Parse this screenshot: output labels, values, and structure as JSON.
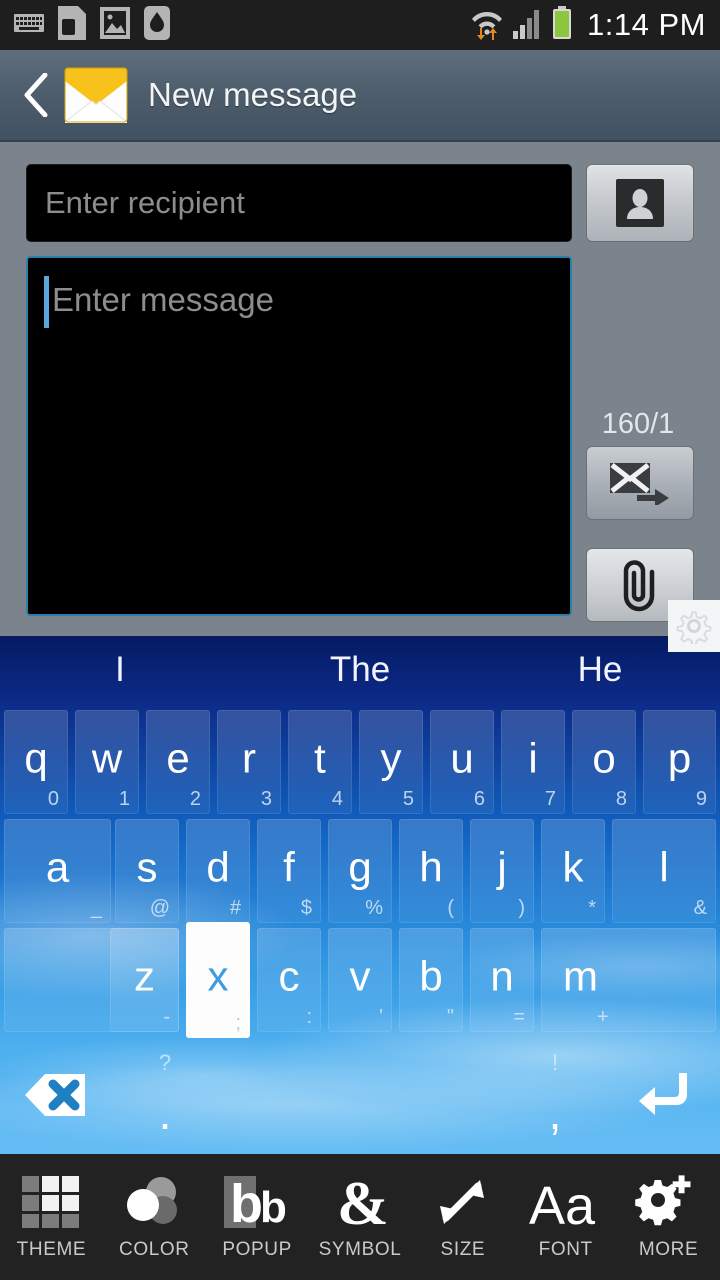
{
  "statusbar": {
    "time": "1:14 PM",
    "left_icons": [
      "keyboard-icon",
      "sim-card-icon",
      "image-icon",
      "droplet-icon"
    ],
    "right_icons": [
      "wifi-icon",
      "signal-icon",
      "battery-icon"
    ]
  },
  "titlebar": {
    "back_label": "‹",
    "icon": "envelope-icon",
    "title": "New message"
  },
  "compose": {
    "recipient_placeholder": "Enter recipient",
    "recipient_value": "",
    "contacts_button": "contacts-icon",
    "message_placeholder": "Enter message",
    "message_value": "",
    "counter": "160/1",
    "send_button": "send-message-icon",
    "attach_button": "paperclip-icon",
    "settings_button": "gear-icon"
  },
  "keyboard": {
    "suggestions": [
      "I",
      "The",
      "He"
    ],
    "rows": [
      [
        {
          "label": "q",
          "hint": "0"
        },
        {
          "label": "w",
          "hint": "1"
        },
        {
          "label": "e",
          "hint": "2"
        },
        {
          "label": "r",
          "hint": "3"
        },
        {
          "label": "t",
          "hint": "4"
        },
        {
          "label": "y",
          "hint": "5"
        },
        {
          "label": "u",
          "hint": "6"
        },
        {
          "label": "i",
          "hint": "7"
        },
        {
          "label": "o",
          "hint": "8"
        },
        {
          "label": "p",
          "hint": "9"
        }
      ],
      [
        {
          "label": "a",
          "hint": "_"
        },
        {
          "label": "s",
          "hint": "@"
        },
        {
          "label": "d",
          "hint": "#"
        },
        {
          "label": "f",
          "hint": "$"
        },
        {
          "label": "g",
          "hint": "%"
        },
        {
          "label": "h",
          "hint": "("
        },
        {
          "label": "j",
          "hint": ")"
        },
        {
          "label": "k",
          "hint": "*"
        },
        {
          "label": "l",
          "hint": "&"
        }
      ],
      [
        {
          "label": "",
          "hint": "",
          "name": "shift-key"
        },
        {
          "label": "z",
          "hint": "-"
        },
        {
          "label": "x",
          "hint": ";",
          "pressed": true
        },
        {
          "label": "c",
          "hint": ":"
        },
        {
          "label": "v",
          "hint": "'"
        },
        {
          "label": "b",
          "hint": "\""
        },
        {
          "label": "n",
          "hint": "="
        },
        {
          "label": "m",
          "hint": "+"
        }
      ]
    ],
    "bottom_row": [
      {
        "name": "backspace-key",
        "main": "",
        "hint": ""
      },
      {
        "name": "period-key",
        "main": ".",
        "hint": "?"
      },
      {
        "name": "space-key",
        "main": "",
        "hint": ""
      },
      {
        "name": "comma-key",
        "main": ",",
        "hint": "!"
      },
      {
        "name": "enter-key",
        "main": "",
        "hint": ""
      }
    ]
  },
  "toolbar": {
    "items": [
      {
        "label": "THEME",
        "icon": "grid-icon"
      },
      {
        "label": "COLOR",
        "icon": "circles-icon"
      },
      {
        "label": "POPUP",
        "icon": "popup-bb-icon"
      },
      {
        "label": "SYMBOL",
        "icon": "ampersand-icon"
      },
      {
        "label": "SIZE",
        "icon": "resize-arrows-icon"
      },
      {
        "label": "FONT",
        "icon": "font-aa-icon"
      },
      {
        "label": "MORE",
        "icon": "gear-plus-icon"
      }
    ]
  },
  "colors": {
    "status_bg": "#1e1e1e",
    "title_bg": "#4e5d6c",
    "compose_bg": "#7b838c",
    "field_bg": "#000000",
    "focus_border": "#2d7ea8",
    "keyboard_top": "#061a63",
    "keyboard_bottom": "#66bdf4",
    "toolbar_bg": "#222222",
    "battery_green": "#8cc63f"
  }
}
